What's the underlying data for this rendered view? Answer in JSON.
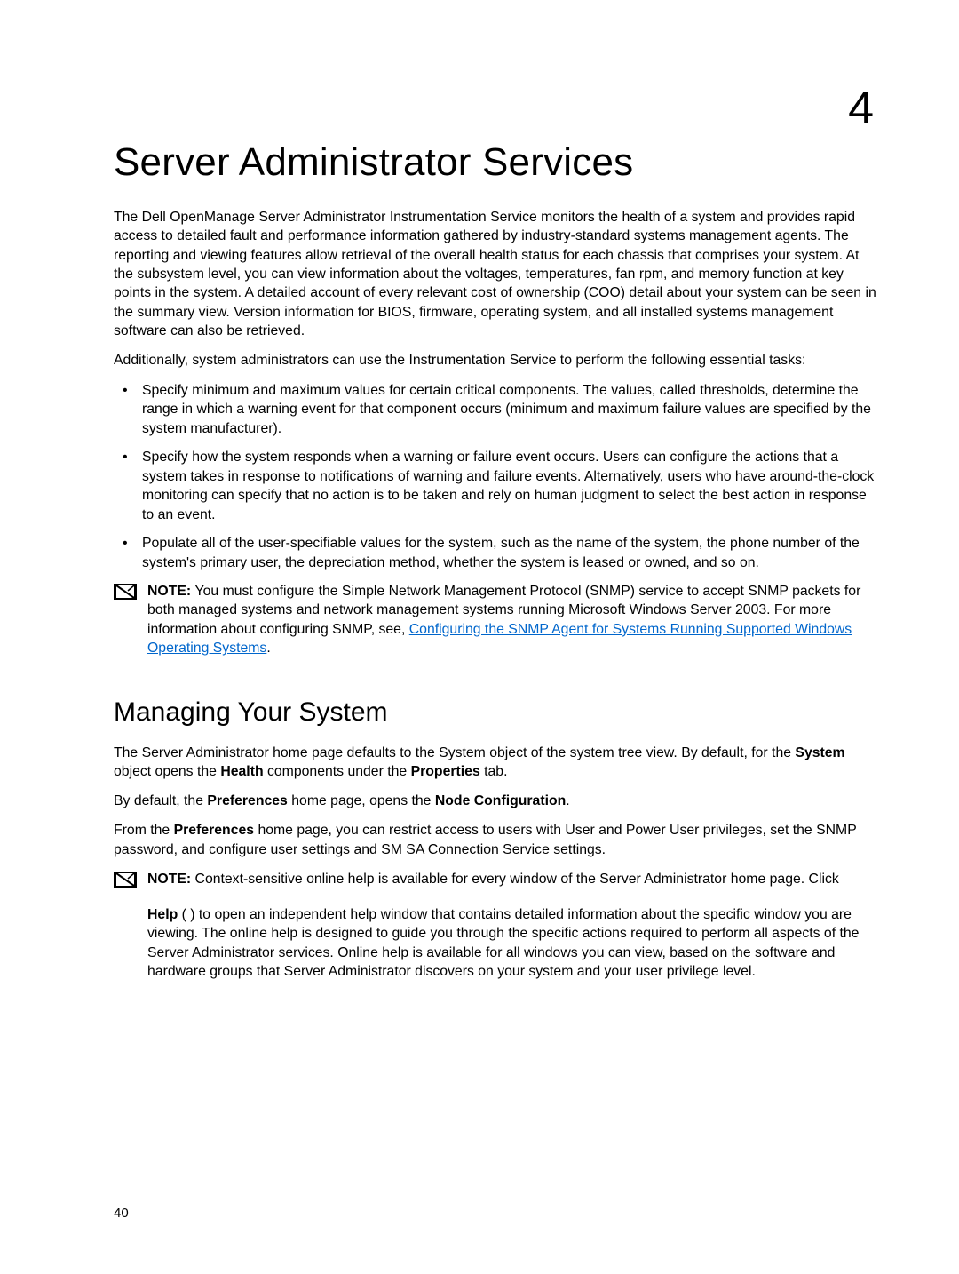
{
  "chapter": "4",
  "title": "Server Administrator Services",
  "intro_p1": "The Dell OpenManage Server Administrator Instrumentation Service monitors the health of a system and provides rapid access to detailed fault and performance information gathered by industry-standard systems management agents. The reporting and viewing features allow retrieval of the overall health status for each chassis that comprises your system. At the subsystem level, you can view information about the voltages, temperatures, fan rpm, and memory function at key points in the system. A detailed account of every relevant cost of ownership (COO) detail about your system can be seen in the summary view. Version information for BIOS, firmware, operating system, and all installed systems management software can also be retrieved.",
  "intro_p2": "Additionally, system administrators can use the Instrumentation Service to perform the following essential tasks:",
  "bullets": {
    "b1": "Specify minimum and maximum values for certain critical components. The values, called thresholds, determine the range in which a warning event for that component occurs (minimum and maximum failure values are specified by the system manufacturer).",
    "b2": "Specify how the system responds when a warning or failure event occurs. Users can configure the actions that a system takes in response to notifications of warning and failure events. Alternatively, users who have around-the-clock monitoring can specify that no action is to be taken and rely on human judgment to select the best action in response to an event.",
    "b3": "Populate all of the user-specifiable values for the system, such as the name of the system, the phone number of the system's primary user, the depreciation method, whether the system is leased or owned, and so on."
  },
  "note1": {
    "label": "NOTE: ",
    "pre": "You must configure the Simple Network Management Protocol (SNMP) service to accept SNMP packets for both managed systems and network management systems running Microsoft Windows Server 2003. For more information about configuring SNMP, see, ",
    "link": "Configuring the SNMP Agent for Systems Running Supported Windows Operating Systems",
    "post": "."
  },
  "section_title": "Managing Your System",
  "mng_p1_pre": "The Server Administrator home page defaults to the System object of the system tree view. By default, for the ",
  "mng_p1_system": "System",
  "mng_p1_mid": " object opens the ",
  "mng_p1_health": "Health",
  "mng_p1_mid2": " components under the ",
  "mng_p1_properties": "Properties",
  "mng_p1_end": " tab.",
  "mng_p2_pre": "By default, the ",
  "mng_p2_pref": "Preferences",
  "mng_p2_mid": " home page, opens the ",
  "mng_p2_node": "Node Configuration",
  "mng_p2_end": ".",
  "mng_p3_pre": "From the ",
  "mng_p3_pref": "Preferences",
  "mng_p3_end": " home page, you can restrict access to users with User and Power User privileges, set the SNMP password, and configure user settings and SM SA Connection Service settings.",
  "note2": {
    "label": "NOTE: ",
    "text": "Context-sensitive online help is available for every window of the Server Administrator home page. Click"
  },
  "note2_sub": {
    "help": "Help",
    "rest": " (           ) to open an independent help window that contains detailed information about the specific window you are viewing. The online help is designed to guide you through the specific actions required to perform all aspects of the Server Administrator services. Online help is available for all windows you can view, based on the software and hardware groups that Server Administrator discovers on your system and your user privilege level."
  },
  "pagenum": "40"
}
